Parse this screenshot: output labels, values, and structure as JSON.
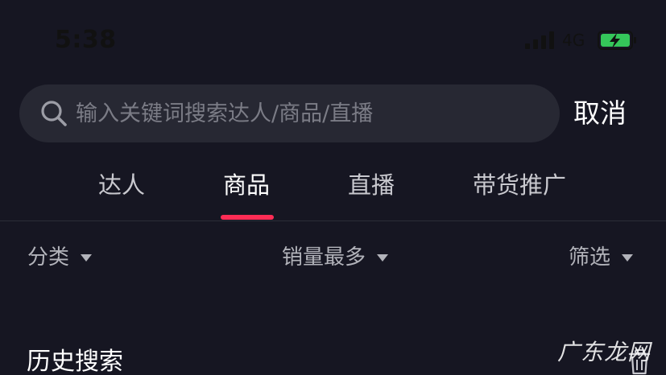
{
  "status_bar": {
    "time": "5:38",
    "network": "4G",
    "signal_icon": "cellular-signal-icon",
    "battery_icon": "battery-charging-icon"
  },
  "search": {
    "placeholder": "输入关键词搜索达人/商品/直播",
    "value": "",
    "icon": "search-icon",
    "cancel_label": "取消"
  },
  "tabs": [
    {
      "label": "达人",
      "active": false
    },
    {
      "label": "商品",
      "active": true
    },
    {
      "label": "直播",
      "active": false
    },
    {
      "label": "带货推广",
      "active": false
    }
  ],
  "filters": [
    {
      "label": "分类",
      "icon": "caret-down-icon"
    },
    {
      "label": "销量最多",
      "icon": "caret-down-icon"
    },
    {
      "label": "筛选",
      "icon": "caret-down-icon"
    }
  ],
  "history": {
    "title": "历史搜索",
    "clear_icon": "trash-icon"
  },
  "watermark": "广东龙网",
  "colors": {
    "background": "#161622",
    "search_bg": "#272833",
    "accent": "#fe2c55",
    "battery": "#35c759",
    "muted_text": "#b2b3ba",
    "placeholder": "#7b7c86"
  }
}
